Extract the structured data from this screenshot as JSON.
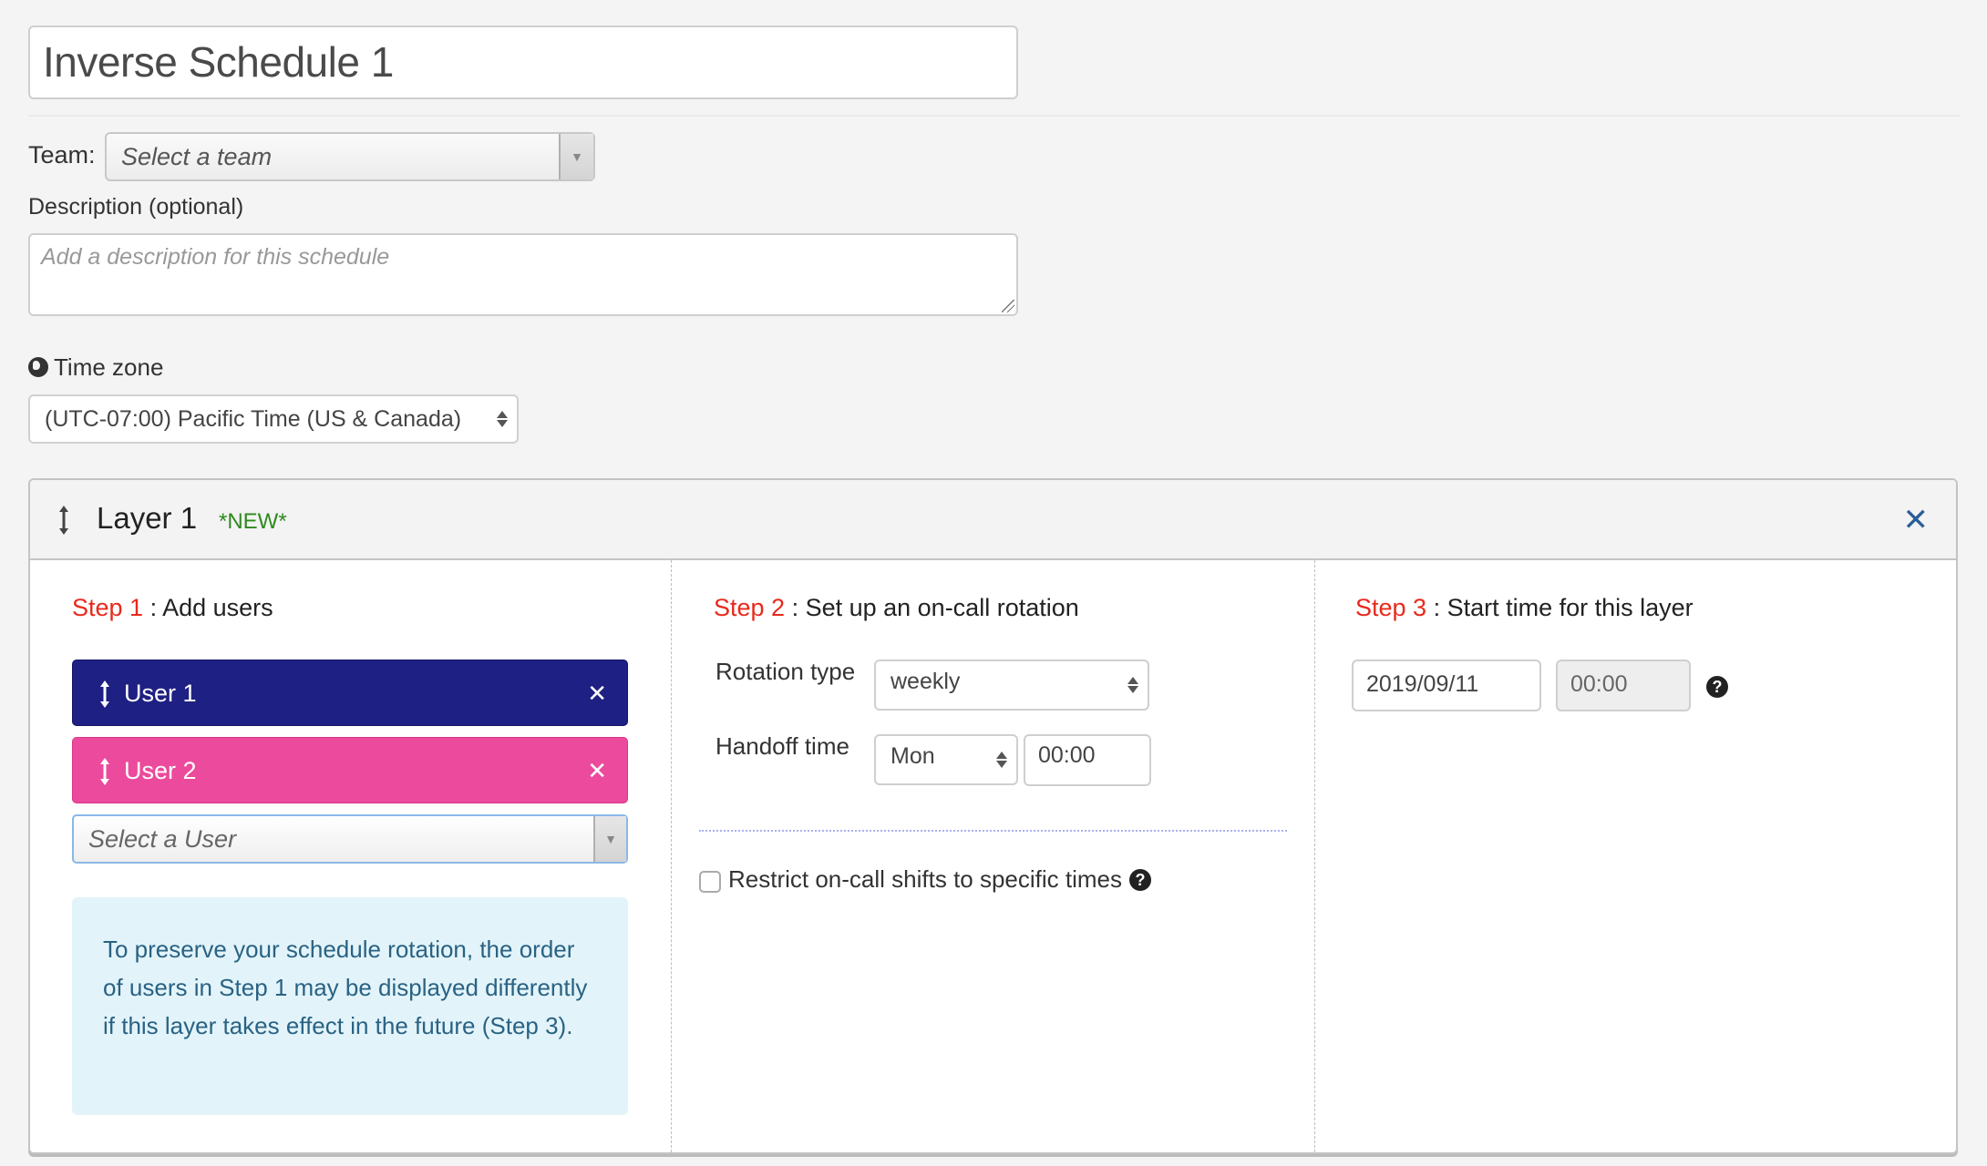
{
  "schedule": {
    "name": "Inverse Schedule 1"
  },
  "team": {
    "label": "Team:",
    "placeholder": "Select a team"
  },
  "description": {
    "label": "Description (optional)",
    "placeholder": "Add a description for this schedule",
    "value": ""
  },
  "timezone": {
    "label": "Time zone",
    "icon": "globe-icon",
    "selected": "(UTC-07:00) Pacific Time (US & Canada)"
  },
  "layer": {
    "title": "Layer 1",
    "badge": "*NEW*",
    "close_icon": "✕",
    "step1": {
      "step_label": "Step 1",
      "heading": " : Add users",
      "users": [
        {
          "name": "User 1",
          "color": "#1e2083",
          "remove": "✕"
        },
        {
          "name": "User 2",
          "color": "#ec4a9c",
          "remove": "✕"
        }
      ],
      "select_user_placeholder": "Select a User",
      "info_text": "To preserve your schedule rotation, the order of users in Step 1 may be displayed differently if this layer takes effect in the future (Step 3)."
    },
    "step2": {
      "step_label": "Step 2",
      "heading": " : Set up an on-call rotation",
      "rotation_type_label": "Rotation type",
      "rotation_type_value": "weekly",
      "handoff_label": "Handoff time",
      "handoff_day": "Mon",
      "handoff_time": "00:00",
      "restrict_label": "Restrict on-call shifts to specific times",
      "restrict_checked": false
    },
    "step3": {
      "step_label": "Step 3",
      "heading": " : Start time for this layer",
      "start_date": "2019/09/11",
      "start_time": "00:00"
    }
  },
  "colors": {
    "step_accent": "#e8291c",
    "new_badge": "#2e8a1e",
    "close_icon": "#2a5e96",
    "info_bg": "#e2f4fa",
    "info_text": "#2a6283"
  }
}
